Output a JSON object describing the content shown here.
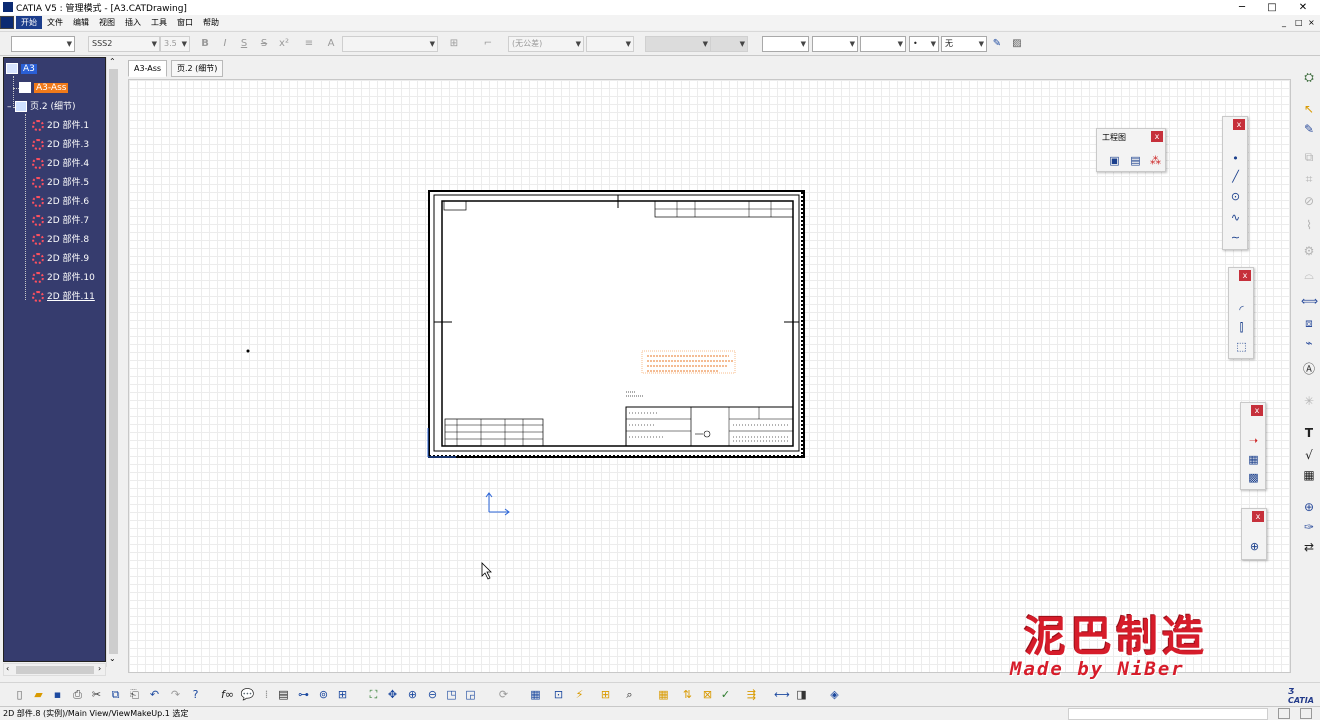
{
  "window": {
    "title": "CATIA V5 : 管理模式 - [A3.CATDrawing]",
    "controls": {
      "minimize": "─",
      "maximize": "□",
      "close": "✕"
    }
  },
  "menubar": {
    "items": [
      "开始",
      "文件",
      "编辑",
      "视图",
      "插入",
      "工具",
      "窗口",
      "帮助"
    ],
    "doc_controls": {
      "minimize": "_",
      "restore": "□",
      "close": "×"
    }
  },
  "toptoolbar": {
    "font_name": "SSS2",
    "font_size": "3.5",
    "bold": "B",
    "italic": "I",
    "underline": "S",
    "strike": "S",
    "superscript": "x²",
    "tolerance": "(无公差)",
    "line_none": "无"
  },
  "tree": {
    "root": "A3",
    "sheet_active": "A3-Ass",
    "sheet_detail": "页.2 (细节)",
    "parts": [
      "2D 部件.1",
      "2D 部件.3",
      "2D 部件.4",
      "2D 部件.5",
      "2D 部件.6",
      "2D 部件.7",
      "2D 部件.8",
      "2D 部件.9",
      "2D 部件.10",
      "2D 部件.11"
    ]
  },
  "tabs": [
    "A3-Ass",
    "页.2 (细节)"
  ],
  "floating_toolbars": {
    "drawing": {
      "title": "工程图"
    }
  },
  "status": {
    "text": "2D 部件.8 (实例)/Main View/ViewMakeUp.1 选定"
  },
  "watermark": {
    "line1": "泥巴制造",
    "line2": "Made by NiBer"
  },
  "colors": {
    "tree_bg": "#363c6e",
    "active_tab": "#ffffff",
    "highlight": "#f07a1a",
    "watermark": "#d61c2a"
  }
}
